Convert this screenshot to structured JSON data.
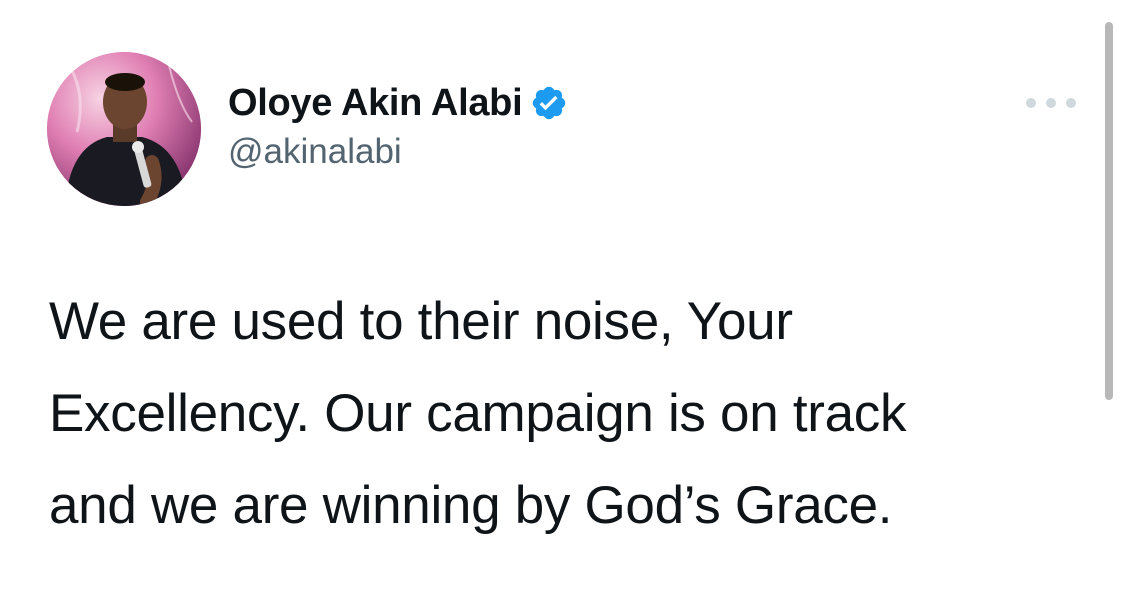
{
  "author": {
    "display_name": "Oloye Akin Alabi",
    "handle": "@akinalabi",
    "verified": true,
    "verified_icon": "verified-badge-icon",
    "avatar_icon": "avatar"
  },
  "menu": {
    "icon": "more-options-icon"
  },
  "tweet": {
    "lines": [
      "We are used to their noise, Your",
      "Excellency. Our campaign is on track",
      "and we are winning by God’s Grace."
    ]
  },
  "colors": {
    "text": "#0f1419",
    "secondary_text": "#536471",
    "verified_blue": "#1d9bf0",
    "menu_dots": "#cfd9de"
  }
}
